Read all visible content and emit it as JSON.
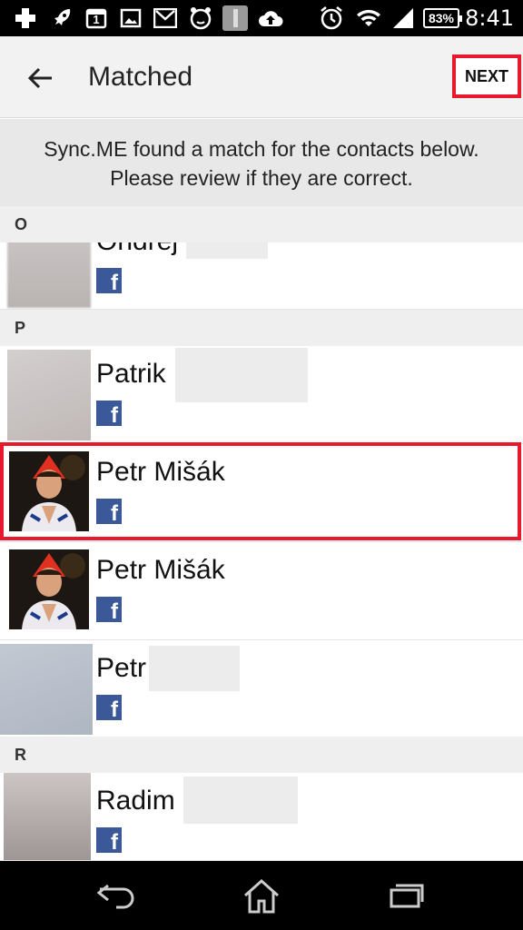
{
  "status_bar": {
    "battery": "83%",
    "time": "8:41",
    "icons": [
      "add-icon",
      "rocket-icon",
      "calendar-icon",
      "image-icon",
      "gmail-icon",
      "alarm-clock-app-icon",
      "app-icon",
      "cloud-upload-icon",
      "alarm-icon",
      "wifi-icon",
      "signal-icon"
    ],
    "calendar_day": "1"
  },
  "toolbar": {
    "title": "Matched",
    "next_label": "NEXT"
  },
  "banner": {
    "line1": "Sync.ME found a match for the contacts below.",
    "line2": "Please review if they are correct."
  },
  "sections": [
    {
      "letter": "O"
    },
    {
      "letter": "P"
    },
    {
      "letter": "R"
    }
  ],
  "contacts": [
    {
      "name": "Ondřej",
      "source": "f"
    },
    {
      "name": "Patrik",
      "source": "f"
    },
    {
      "name": "Petr Mišák",
      "source": "f",
      "highlighted": true
    },
    {
      "name": "Petr Mišák",
      "source": "f"
    },
    {
      "name": "Petr",
      "source": "f"
    },
    {
      "name": "Radim",
      "source": "f"
    }
  ],
  "colors": {
    "highlight": "#e8192c",
    "facebook": "#3b5998",
    "toolbar_bg": "#f2f2f2"
  },
  "nav_bar": {
    "icons": [
      "back-nav-icon",
      "home-icon",
      "recents-icon"
    ]
  }
}
